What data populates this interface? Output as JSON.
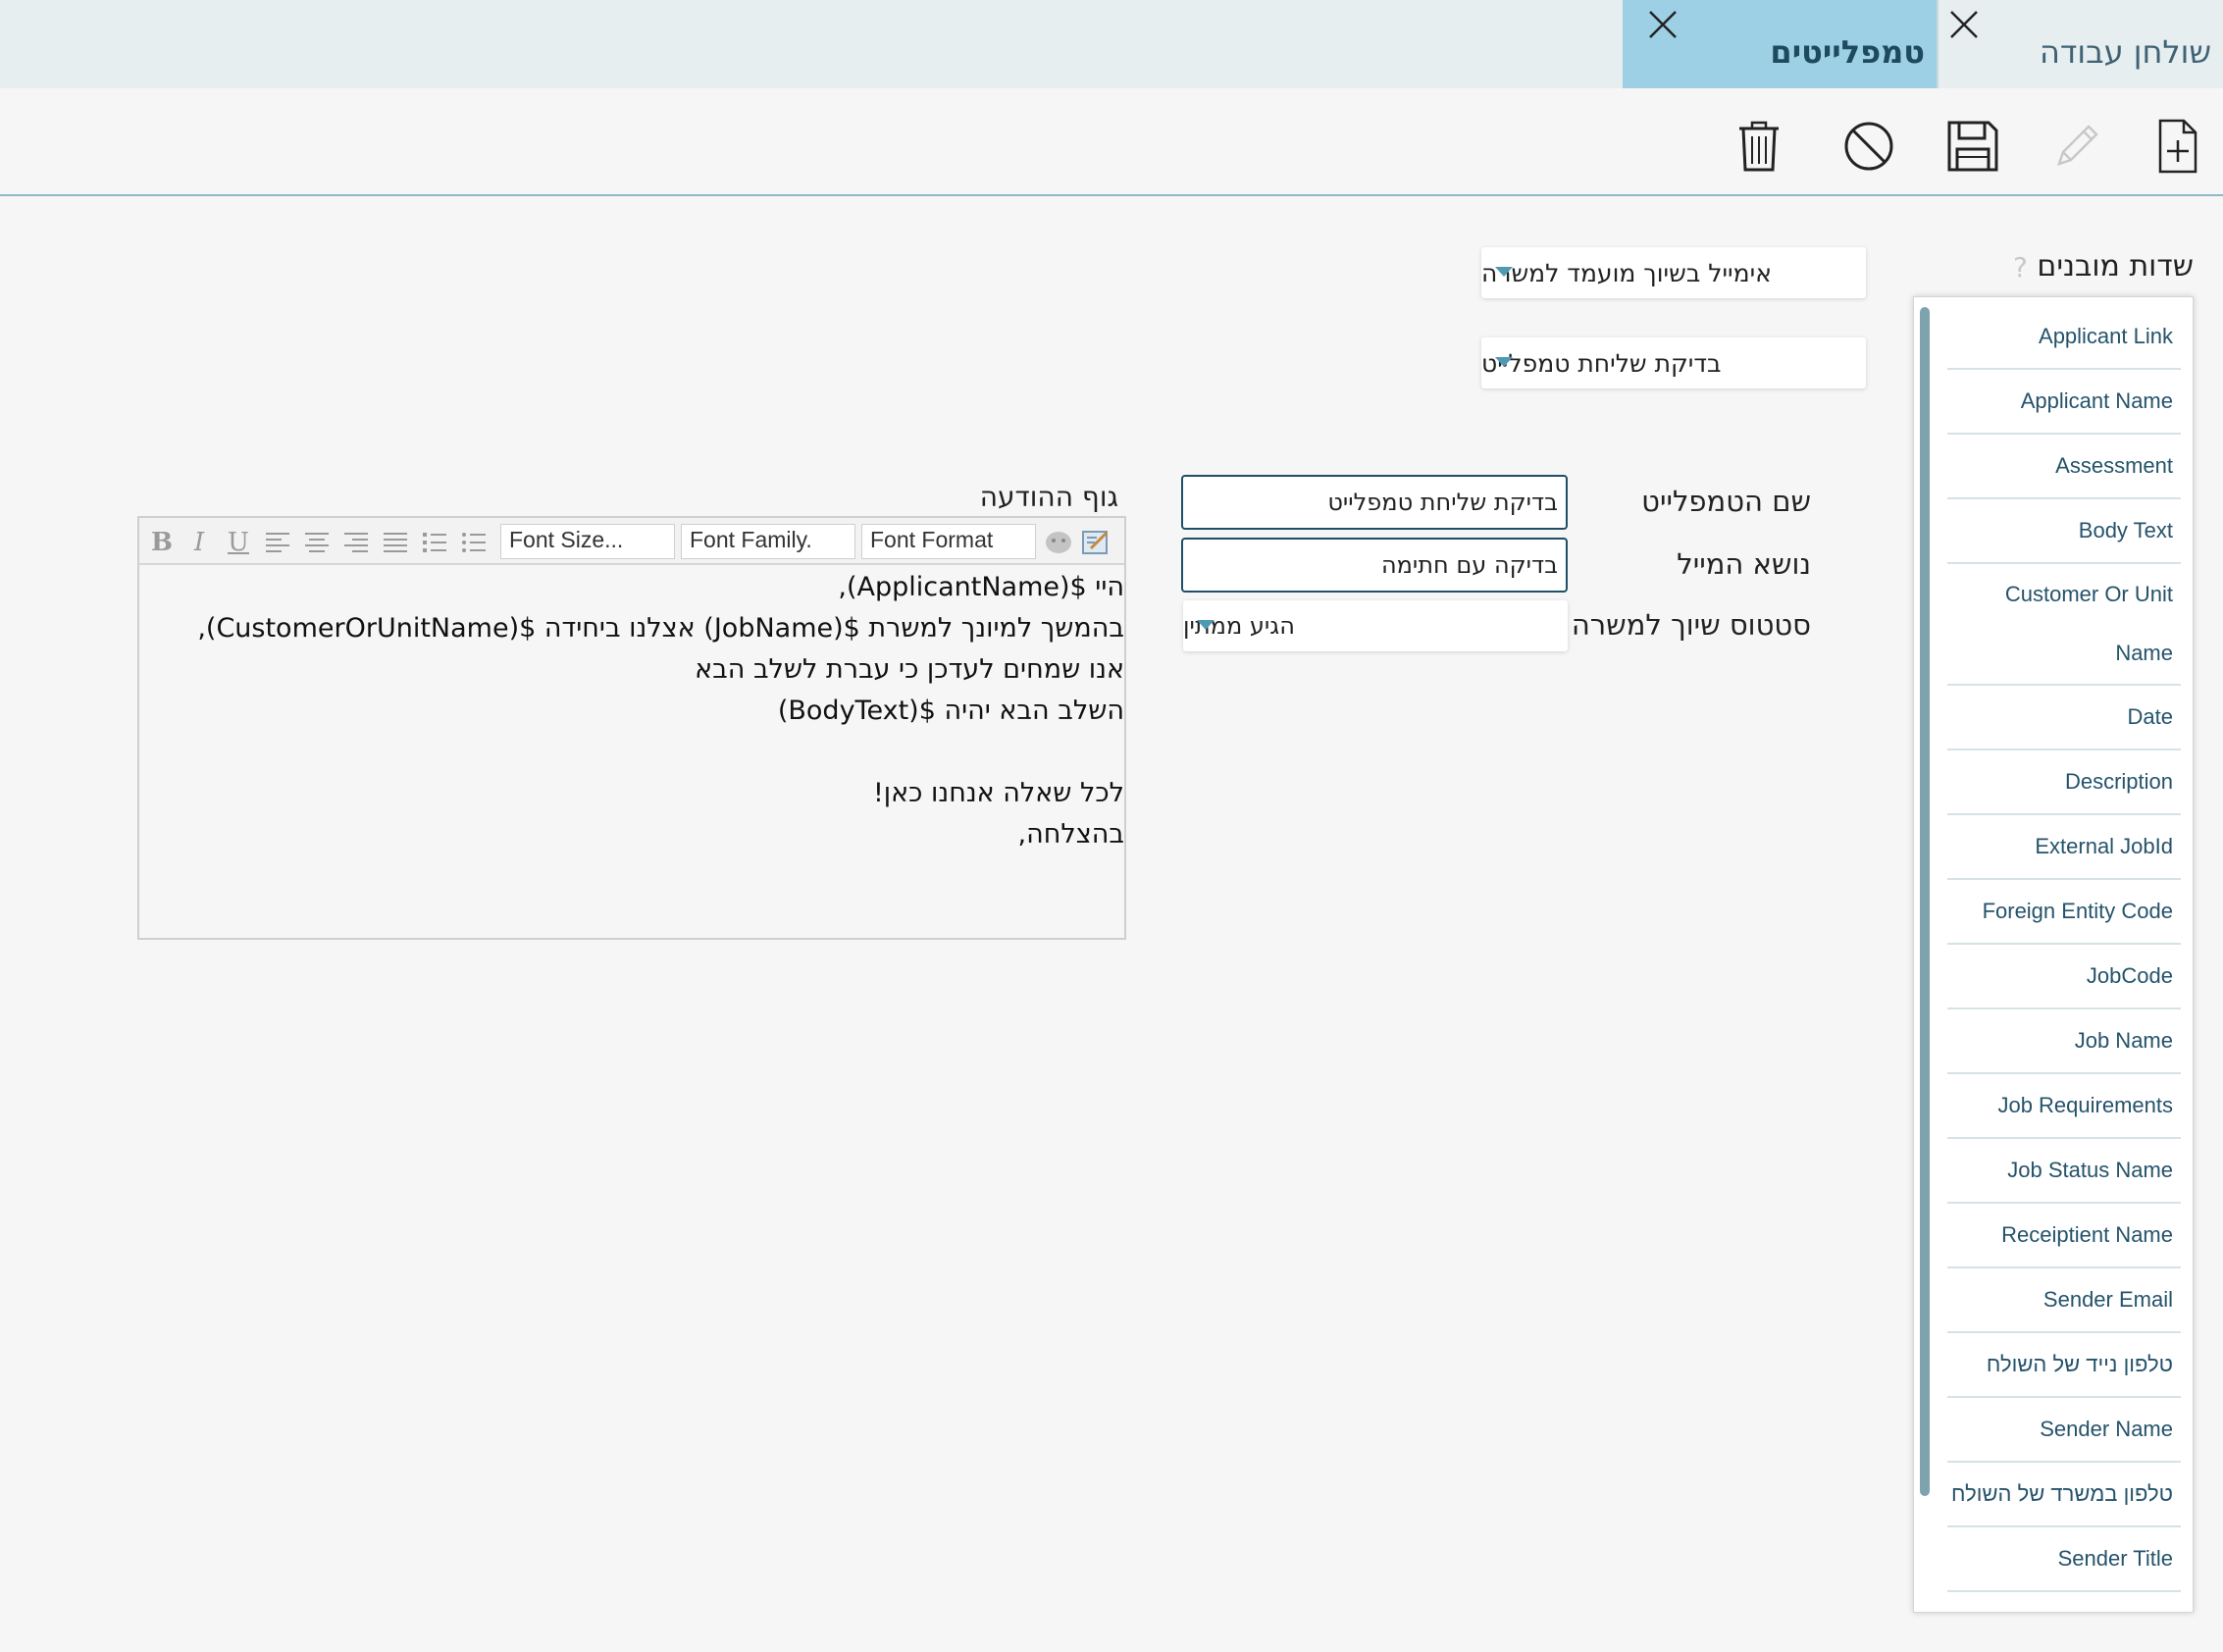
{
  "tabs": [
    {
      "label": "שולחן עבודה",
      "active": false
    },
    {
      "label": "טמפלייטים",
      "active": true
    }
  ],
  "toolbar": {
    "icons": [
      "new-document-icon",
      "edit-icon",
      "save-icon",
      "cancel-icon",
      "delete-icon"
    ]
  },
  "fields": {
    "title": "שדות מובנים",
    "help": "?",
    "items": [
      "Applicant Link",
      "Applicant Name",
      "Assessment",
      "Body Text",
      "Customer Or Unit Name",
      "Date",
      "Description",
      "External JobId",
      "Foreign Entity Code",
      "JobCode",
      "Job Name",
      "Job Requirements",
      "Job Status Name",
      "Receiptient Name",
      "Sender Email",
      "טלפון נייד של השולח",
      "Sender Name",
      "טלפון במשרד של השולח",
      "Sender Title"
    ],
    "customer_line1": "Customer Or Unit",
    "customer_line2": "Name"
  },
  "selects": {
    "category": "אימייל בשיוך מועמד למשרה",
    "template": "בדיקת שליחת טמפלייט"
  },
  "form": {
    "template_name_label": "שם הטמפלייט",
    "template_name_value": "בדיקת שליחת טמפלייט",
    "subject_label": "נושא המייל",
    "subject_value": "בדיקה עם חתימה",
    "status_label": "סטטוס שיוך למשרה",
    "status_value": "הגיע ממתין",
    "body_label": "גוף ההודעה"
  },
  "editor": {
    "font_format": "Font Format",
    "font_family": "Font Family.",
    "font_size": "Font Size...",
    "lines": [
      "היי $(ApplicantName),",
      "בהמשך למיונך למשרת $(JobName) אצלנו ביחידה $(CustomerOrUnitName),",
      "אנו שמחים לעדכן כי עברת לשלב הבא",
      "השלב הבא יהיה $(BodyText)",
      "",
      "לכל שאלה אנחנו כאן!",
      "בהצלחה,"
    ]
  },
  "colors": {
    "active_tab": "#9dd0e5",
    "tabbar": "#e6eef0",
    "accent": "#4e9ab2",
    "field_text": "#25536b",
    "input_border": "#1f4f66"
  }
}
